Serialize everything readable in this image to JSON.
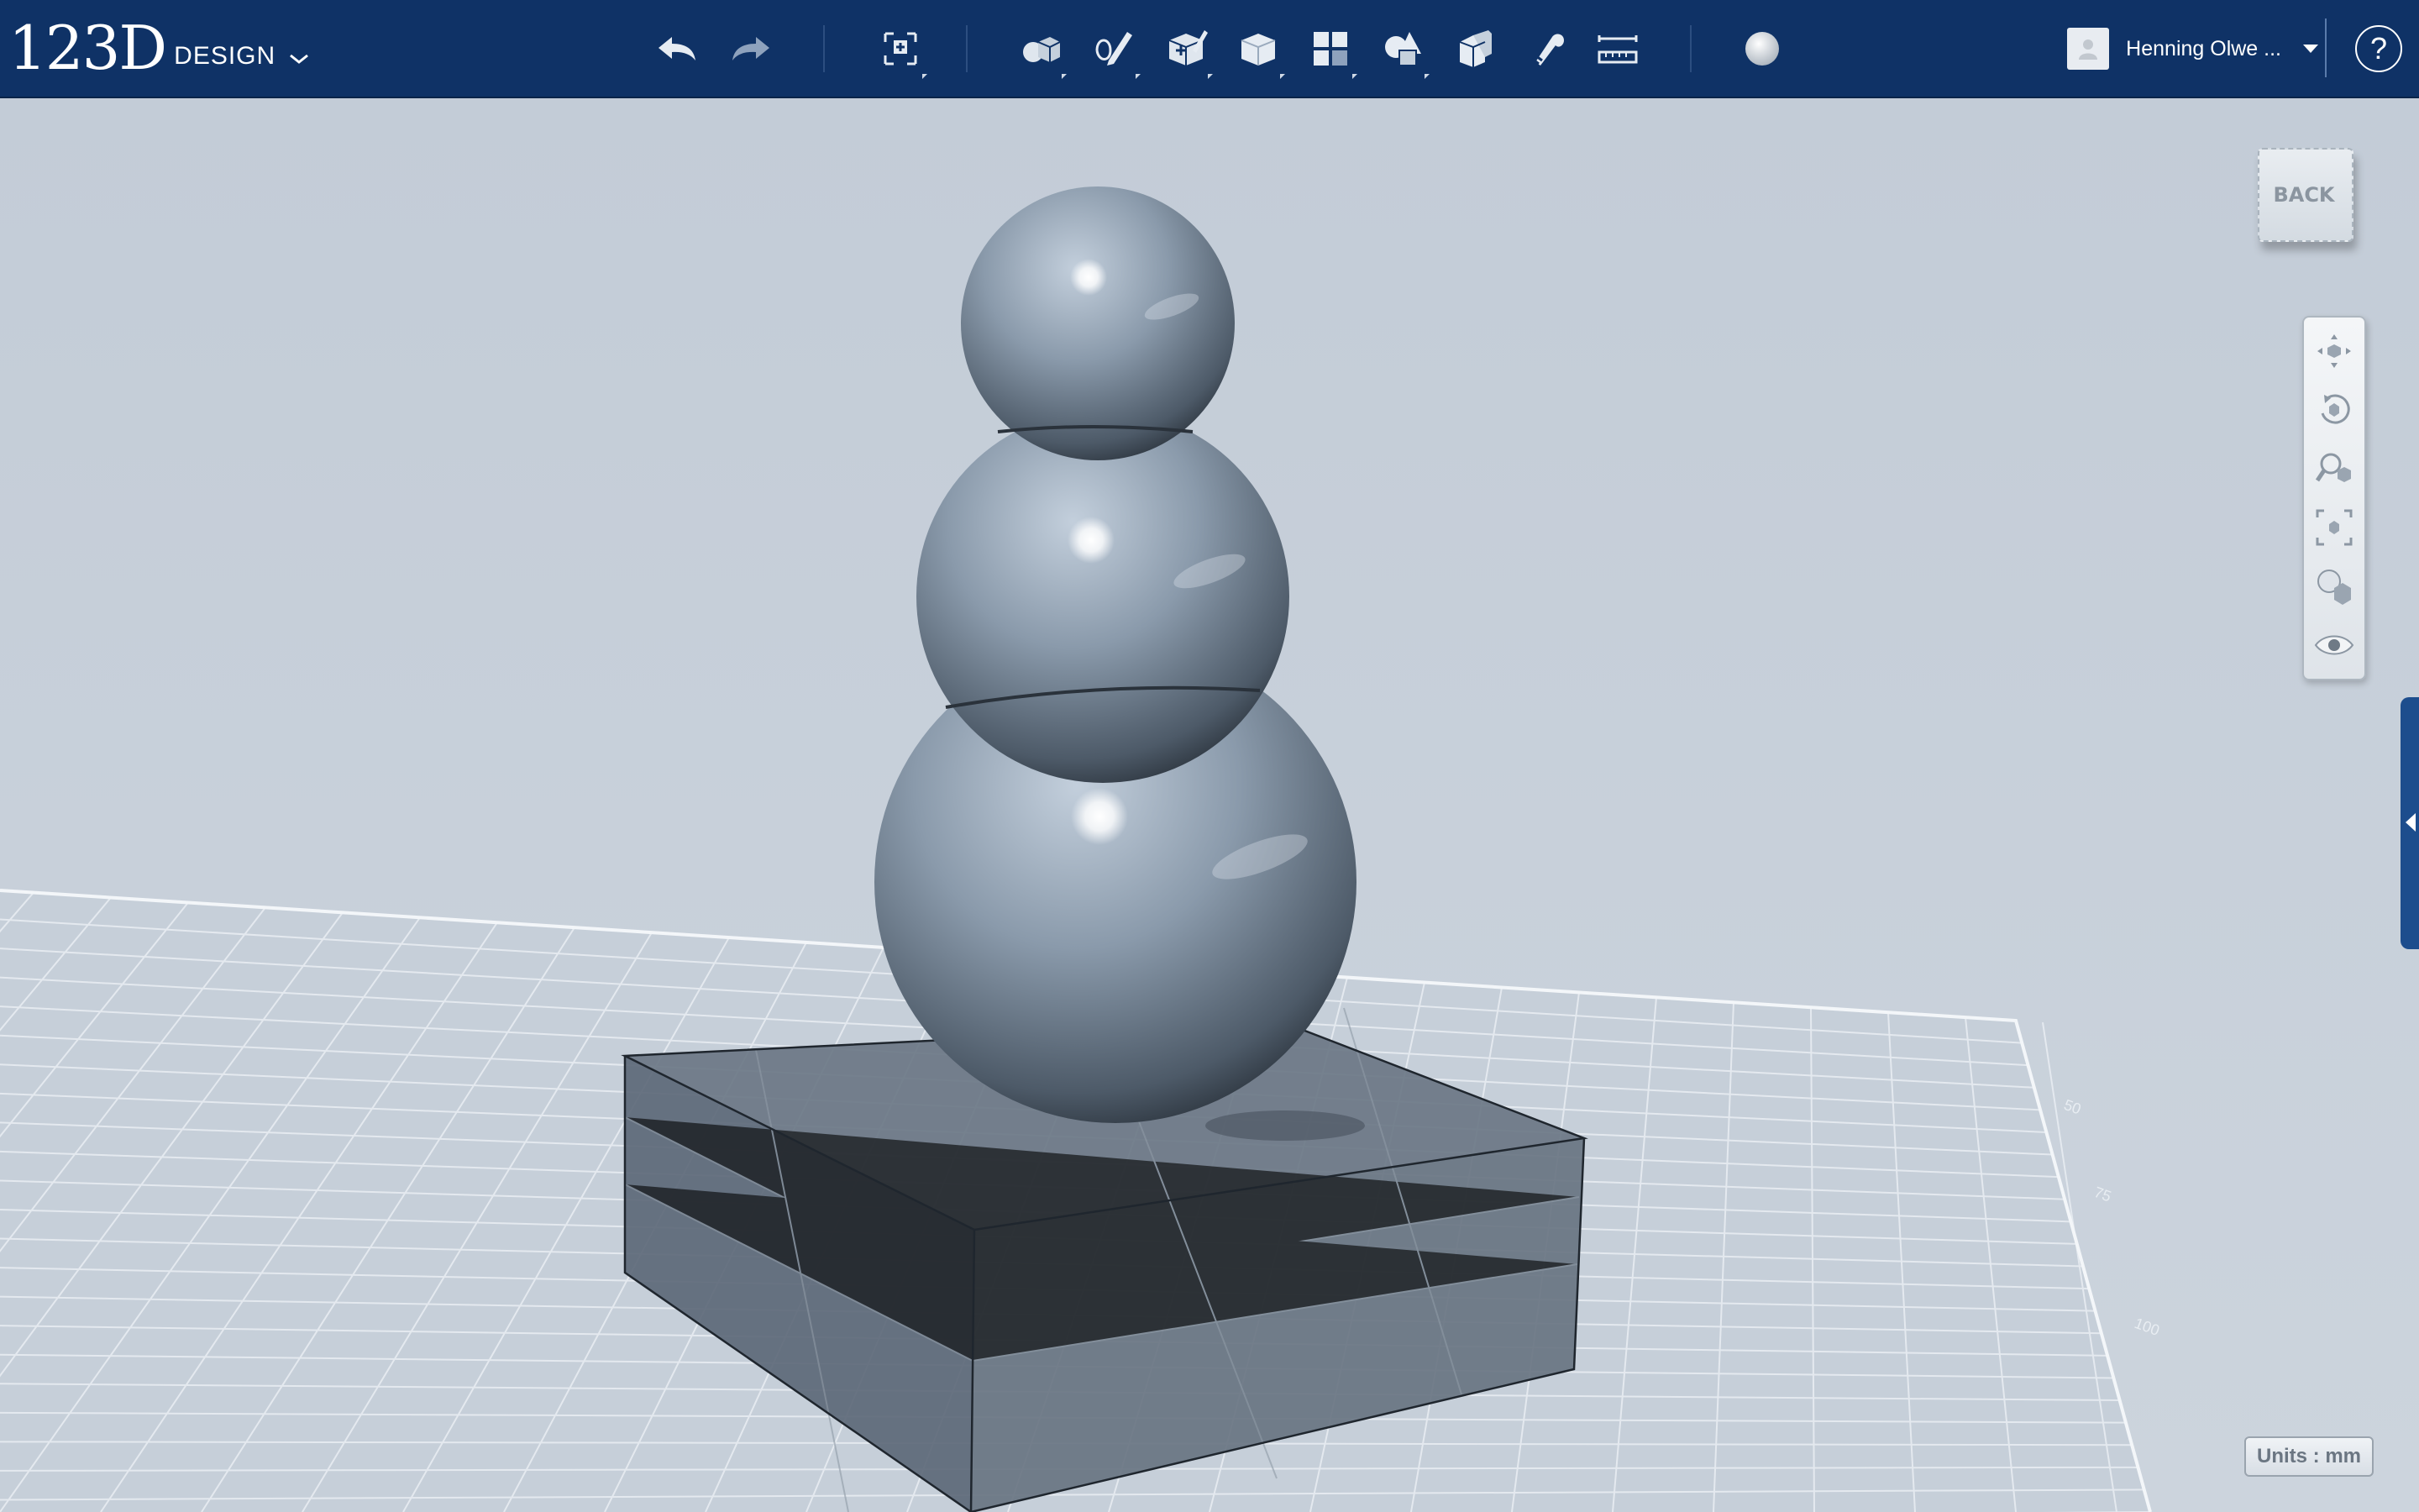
{
  "app": {
    "logo_number": "123D",
    "logo_product": "DESIGN"
  },
  "toolbar": {
    "tools": [
      {
        "id": "undo",
        "icon": "undo-icon"
      },
      {
        "id": "redo",
        "icon": "redo-icon"
      },
      {
        "id": "transform",
        "icon": "transform-icon"
      },
      {
        "id": "primitives",
        "icon": "primitives-icon"
      },
      {
        "id": "sketch",
        "icon": "sketch-icon"
      },
      {
        "id": "construct",
        "icon": "construct-icon"
      },
      {
        "id": "modify",
        "icon": "modify-icon"
      },
      {
        "id": "pattern",
        "icon": "pattern-icon"
      },
      {
        "id": "grouping",
        "icon": "grouping-icon"
      },
      {
        "id": "combine",
        "icon": "combine-icon"
      },
      {
        "id": "snap",
        "icon": "snap-icon"
      },
      {
        "id": "measure",
        "icon": "measure-icon"
      },
      {
        "id": "material",
        "icon": "material-icon"
      }
    ]
  },
  "user": {
    "name": "Henning Olwe ..."
  },
  "help": {
    "label": "?"
  },
  "viewcube": {
    "face_label": "BACK"
  },
  "navbar": {
    "buttons": [
      "pan-icon",
      "orbit-icon",
      "zoom-icon",
      "fit-icon",
      "view-mode-icon",
      "visibility-icon"
    ]
  },
  "status": {
    "units_label": "Units : mm"
  },
  "grid_ruler": {
    "labels": [
      "50",
      "75",
      "100"
    ]
  },
  "colors": {
    "topbar": "#0f3266",
    "viewport_bg": "#c9d2dc",
    "model": "#7f8e9f",
    "box_face": "#5e6b7a"
  }
}
